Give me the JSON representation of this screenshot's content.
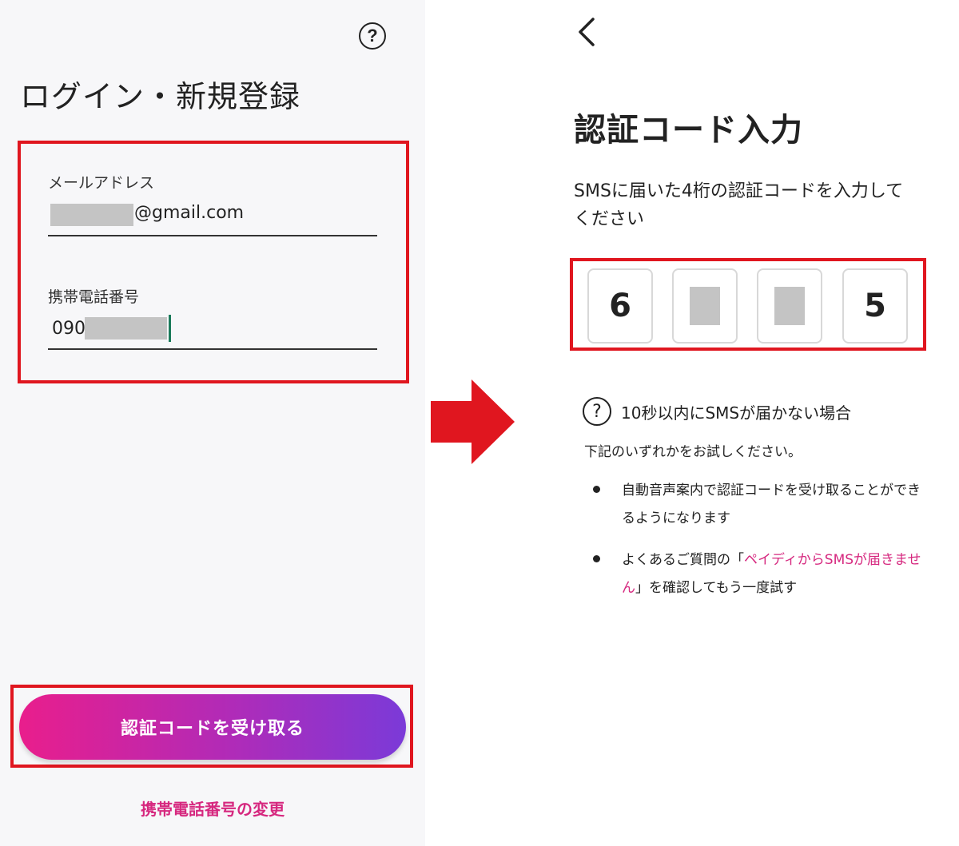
{
  "login": {
    "title": "ログイン・新規登録",
    "help_icon": "question-circle-icon",
    "email_label": "メールアドレス",
    "email_domain": "@gmail.com",
    "phone_label": "携帯電話番号",
    "phone_prefix": "090",
    "submit_label": "認証コードを受け取る",
    "change_phone_link": "携帯電話番号の変更"
  },
  "verify": {
    "back_icon": "chevron-left-icon",
    "title": "認証コード入力",
    "instruction": "SMSに届いた4桁の認証コードを入力してください",
    "digits": [
      "6",
      "",
      "",
      "5"
    ],
    "no_sms_heading": "10秒以内にSMSが届かない場合",
    "try_text": "下記のいずれかをお試しください。",
    "bullet_1": "自動音声案内で認証コードを受け取ることができるようになります",
    "bullet_2_before": "よくあるご質問の「",
    "bullet_2_link": "ペイディからSMSが届きません",
    "bullet_2_after": "」を確認してもう一度試す"
  },
  "colors": {
    "highlight": "#e0161f",
    "brand_pink": "#d6287f",
    "gradient_start": "#e91e8c",
    "gradient_end": "#7b3ad8",
    "arrow": "#e0161f"
  },
  "icons": {
    "transition_arrow": "arrow-right-icon",
    "help": "question-circle-icon"
  }
}
